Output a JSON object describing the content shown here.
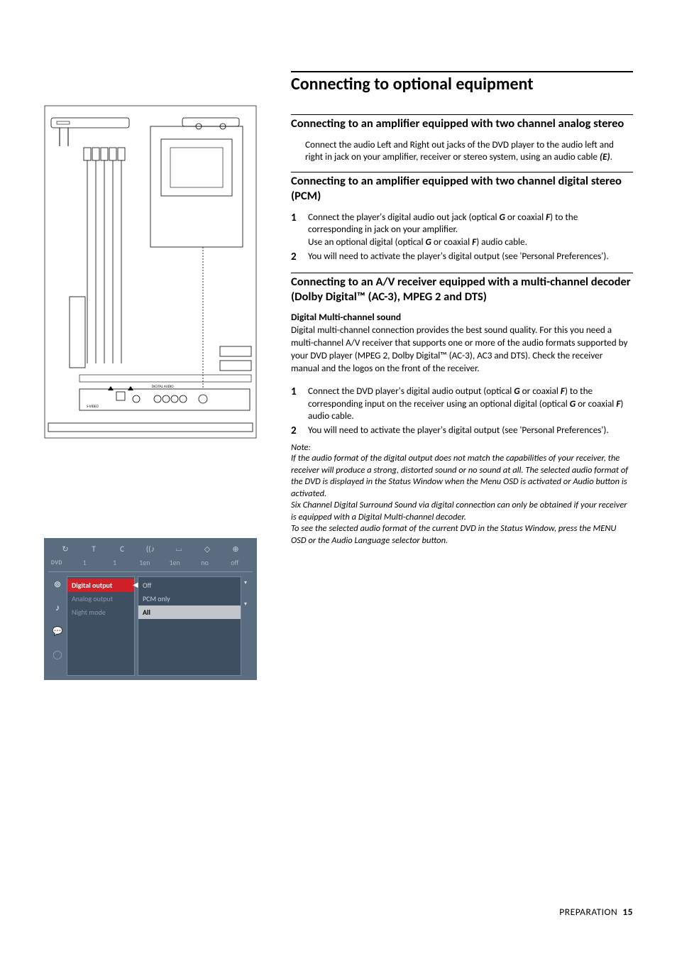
{
  "page": {
    "title": "Connecting to optional equipment",
    "footer_label": "PREPARATION",
    "footer_page": "15"
  },
  "sec_analog": {
    "heading": "Connecting to an amplifier equipped with two channel analog stereo",
    "body_before": "Connect the audio Left and Right out jacks of the DVD player to the audio left and right in jack on your amplifier, receiver or stereo system, using an audio cable ",
    "cable_ref": "(E)",
    "body_after": "."
  },
  "sec_pcm": {
    "heading": "Connecting to an amplifier equipped with two channel digital stereo (PCM)",
    "step1_a": "Connect the player's digital audio out jack (optical ",
    "step1_g": "G",
    "step1_b": " or coaxial ",
    "step1_f": "F",
    "step1_c": ") to the corresponding in jack on your amplifier.",
    "step1_line2_a": "Use an optional digital (optical ",
    "step1_line2_b": " or coaxial ",
    "step1_line2_c": ") audio cable.",
    "step2": "You will need to activate the player's digital output (see 'Personal Preferences')."
  },
  "sec_av": {
    "heading": "Connecting to an A/V receiver equipped with a multi-channel decoder (Dolby Digital™ (AC-3), MPEG 2 and DTS)",
    "subhead": "Digital Multi-channel sound",
    "para": "Digital multi-channel connection provides the best sound quality. For this you need a multi-channel A/V receiver that supports one or more of the audio formats supported by your DVD player (MPEG 2, Dolby Digital™ (AC-3), AC3 and DTS). Check the receiver manual and the logos on the front of the receiver.",
    "step1_a": "Connect the DVD player's digital audio output (optical ",
    "step1_g": "G",
    "step1_b": " or coaxial ",
    "step1_f": "F",
    "step1_c": ") to the corresponding input on the receiver using an optional digital (optical ",
    "step1_d": " or coaxial ",
    "step1_e": ") audio cable.",
    "step2": "You will need to activate the player's digital output (see 'Personal Preferences')."
  },
  "note": {
    "label": "Note:",
    "p1": "If the audio format of the digital output does not match the capabilities of your receiver, the receiver will produce a strong, distorted sound or no sound at all. The selected audio format of the DVD is displayed in the Status Window when the Menu OSD is activated or Audio button is activated.",
    "p2": "Six Channel Digital Surround Sound via digital connection can only be obtained if your receiver is equipped with a Digital Multi-channel decoder.",
    "p3": "To see the selected audio format of the current DVD in the Status Window, press the MENU OSD or the Audio Language selector button."
  },
  "osd": {
    "top_icons": [
      "↻",
      "T",
      "C",
      "((♪",
      "⌴",
      "◇",
      "⊕"
    ],
    "top_vals_prefix": "DVD",
    "top_vals": [
      "1",
      "1",
      "1en",
      "1en",
      "no",
      "off"
    ],
    "side_icons": [
      "⊚",
      "♪",
      "💬",
      "◯"
    ],
    "menu_items": [
      {
        "label": "Digital output",
        "sel": true
      },
      {
        "label": "Analog output",
        "sel": false
      },
      {
        "label": "Night mode",
        "sel": false
      }
    ],
    "drop_items": [
      {
        "label": "Off",
        "sel": false
      },
      {
        "label": "PCM only",
        "sel": false
      },
      {
        "label": "All",
        "sel": true
      }
    ]
  }
}
